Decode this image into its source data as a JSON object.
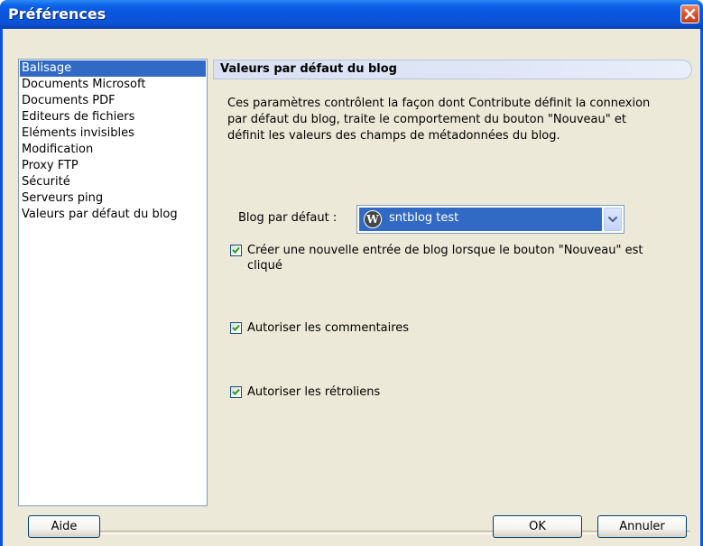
{
  "window": {
    "title": "Préférences",
    "close_icon": "close-icon"
  },
  "sidebar": {
    "items": [
      {
        "label": "Balisage",
        "selected": true
      },
      {
        "label": "Documents Microsoft",
        "selected": false
      },
      {
        "label": "Documents PDF",
        "selected": false
      },
      {
        "label": "Editeurs de fichiers",
        "selected": false
      },
      {
        "label": "Eléments invisibles",
        "selected": false
      },
      {
        "label": "Modification",
        "selected": false
      },
      {
        "label": "Proxy FTP",
        "selected": false
      },
      {
        "label": "Sécurité",
        "selected": false
      },
      {
        "label": "Serveurs ping",
        "selected": false
      },
      {
        "label": "Valeurs par défaut du blog",
        "selected": false
      }
    ]
  },
  "panel": {
    "header": "Valeurs par défaut du blog",
    "description_lines": [
      "Ces paramètres contrôlent la façon dont Contribute définit la connexion",
      "par défaut du blog, traite le comportement du bouton \"Nouveau\" et",
      "définit les valeurs des champs de métadonnées du blog."
    ],
    "default_blog_label": "Blog par défaut :",
    "default_blog_value": "sntblog test",
    "default_blog_icon": "wordpress-icon",
    "options": [
      {
        "label_lines": [
          "Créer une nouvelle entrée de blog lorsque le bouton \"Nouveau\" est",
          "cliqué"
        ],
        "checked": true
      },
      {
        "label_lines": [
          "Autoriser les commentaires"
        ],
        "checked": true
      },
      {
        "label_lines": [
          "Autoriser les rétroliens"
        ],
        "checked": true
      }
    ]
  },
  "buttons": {
    "help": "Aide",
    "ok": "OK",
    "cancel": "Annuler"
  },
  "colors": {
    "titlebar": "#0a55df",
    "selection": "#316ac5",
    "dialog_bg": "#ece9d8",
    "checkmark": "#21a121"
  }
}
